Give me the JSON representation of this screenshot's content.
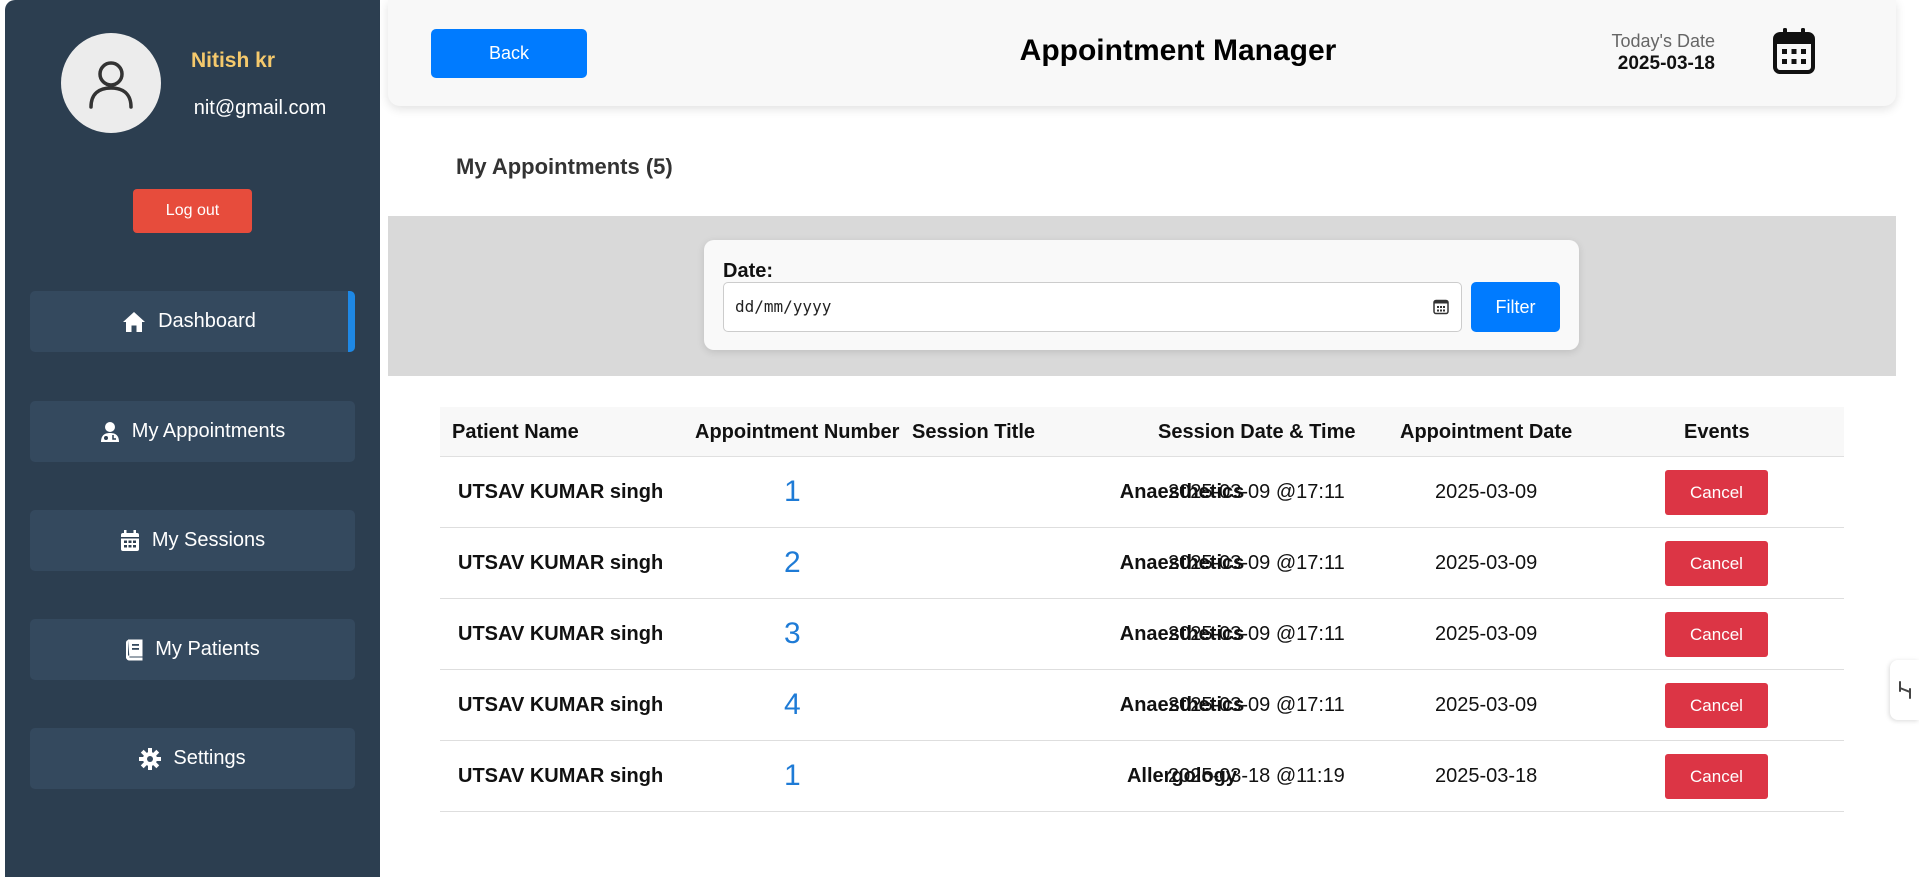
{
  "profile": {
    "name": "Nitish kr",
    "email": "nit@gmail.com",
    "logout_label": "Log out"
  },
  "sidebar": {
    "items": [
      {
        "label": "Dashboard",
        "icon": "home-icon",
        "active": true
      },
      {
        "label": "My Appointments",
        "icon": "doctor-icon",
        "active": false
      },
      {
        "label": "My Sessions",
        "icon": "calendar-icon",
        "active": false
      },
      {
        "label": "My Patients",
        "icon": "book-icon",
        "active": false
      },
      {
        "label": "Settings",
        "icon": "gear-icon",
        "active": false
      }
    ]
  },
  "header": {
    "back_label": "Back",
    "title": "Appointment Manager",
    "date_label": "Today's Date",
    "date_value": "2025-03-18"
  },
  "main": {
    "section_title": "My Appointments (5)"
  },
  "filter": {
    "label": "Date:",
    "placeholder": "dd/mm/yyyy",
    "button_label": "Filter"
  },
  "table": {
    "columns": [
      "Patient Name",
      "Appointment Number",
      "Session Title",
      "Session Date & Time",
      "Appointment Date",
      "Events"
    ],
    "rows": [
      {
        "patient": "UTSAV KUMAR singh",
        "number": "1",
        "session": "Anaesthetics",
        "session_datetime": "2025-03-09 @17:11",
        "appointment_date": "2025-03-09",
        "action": "Cancel"
      },
      {
        "patient": "UTSAV KUMAR singh",
        "number": "2",
        "session": "Anaesthetics",
        "session_datetime": "2025-03-09 @17:11",
        "appointment_date": "2025-03-09",
        "action": "Cancel"
      },
      {
        "patient": "UTSAV KUMAR singh",
        "number": "3",
        "session": "Anaesthetics",
        "session_datetime": "2025-03-09 @17:11",
        "appointment_date": "2025-03-09",
        "action": "Cancel"
      },
      {
        "patient": "UTSAV KUMAR singh",
        "number": "4",
        "session": "Anaesthetics",
        "session_datetime": "2025-03-09 @17:11",
        "appointment_date": "2025-03-09",
        "action": "Cancel"
      },
      {
        "patient": "UTSAV KUMAR singh",
        "number": "1",
        "session": "Allergology",
        "session_datetime": "2025-03-18 @11:19",
        "appointment_date": "2025-03-18",
        "action": "Cancel"
      }
    ]
  },
  "colors": {
    "sidebar_bg": "#2c3e50",
    "nav_item_bg": "#34495e",
    "accent_blue": "#007bff",
    "danger_red": "#dc3545",
    "logout_red": "#e74c3c",
    "name_gold": "#f5c96c"
  }
}
